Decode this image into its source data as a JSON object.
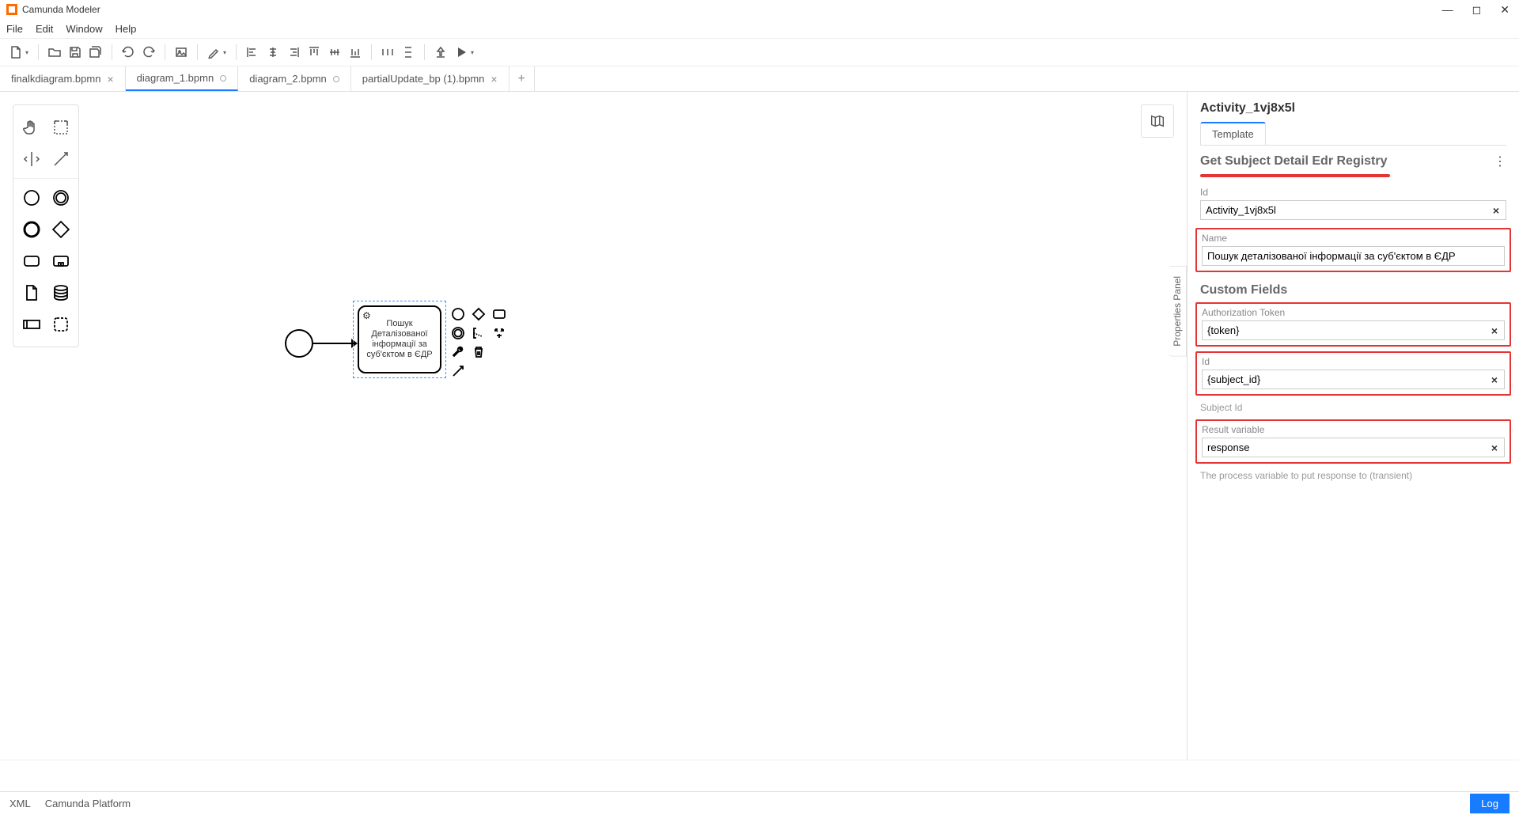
{
  "app": {
    "title": "Camunda Modeler"
  },
  "menu": {
    "file": "File",
    "edit": "Edit",
    "window": "Window",
    "help": "Help"
  },
  "tabs": [
    {
      "label": "finalkdiagram.bpmn",
      "dirty": false,
      "closable": true
    },
    {
      "label": "diagram_1.bpmn",
      "dirty": true,
      "closable": false
    },
    {
      "label": "diagram_2.bpmn",
      "dirty": true,
      "closable": false
    },
    {
      "label": "partialUpdate_bp (1).bpmn",
      "dirty": false,
      "closable": true
    }
  ],
  "canvas": {
    "task_text": "Пошук Деталізованої інформації за суб'єктом в ЄДР"
  },
  "side_tab": "Properties Panel",
  "props": {
    "header": "Activity_1vj8x5l",
    "tab": "Template",
    "template_name": "Get Subject Detail Edr Registry",
    "id_label": "Id",
    "id_value": "Activity_1vj8x5l",
    "name_label": "Name",
    "name_value": "Пошук деталізованої інформації за суб'єктом в ЄДР",
    "custom_fields": "Custom Fields",
    "auth_label": "Authorization Token",
    "auth_value": "{token}",
    "id2_label": "Id",
    "id2_value": "{subject_id}",
    "id2_helper": "Subject Id",
    "result_label": "Result variable",
    "result_value": "response",
    "result_helper": "The process variable to put response to (transient)"
  },
  "status": {
    "xml": "XML",
    "platform": "Camunda Platform",
    "log": "Log"
  }
}
